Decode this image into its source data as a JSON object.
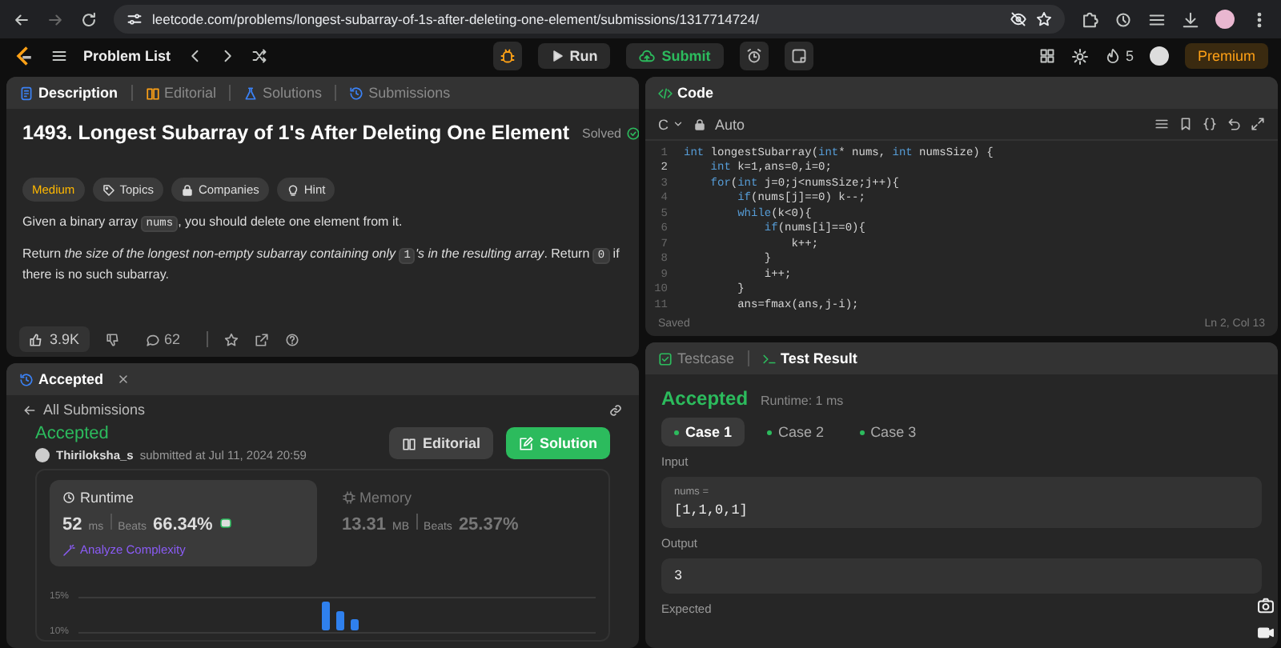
{
  "browser": {
    "url": "leetcode.com/problems/longest-subarray-of-1s-after-deleting-one-element/submissions/1317714724/"
  },
  "topbar": {
    "problem_list": "Problem List",
    "run": "Run",
    "submit": "Submit",
    "streak": "5",
    "premium": "Premium"
  },
  "description": {
    "tabs": [
      {
        "label": "Description",
        "selected": true
      },
      {
        "label": "Editorial",
        "selected": false
      },
      {
        "label": "Solutions",
        "selected": false
      },
      {
        "label": "Submissions",
        "selected": false
      }
    ],
    "title": "1493. Longest Subarray of 1's After Deleting One Element",
    "status": "Solved",
    "tags": [
      {
        "label": "Medium",
        "kind": "difficulty"
      },
      {
        "label": "Topics",
        "kind": "topics"
      },
      {
        "label": "Companies",
        "kind": "companies"
      },
      {
        "label": "Hint",
        "kind": "hint"
      }
    ],
    "paragraphs": [
      [
        {
          "kind": "plain",
          "text": "Given a binary array "
        },
        {
          "kind": "code",
          "text": "nums"
        },
        {
          "kind": "plain",
          "text": ", you should delete one element from it."
        }
      ],
      [
        {
          "kind": "plain",
          "text": "Return "
        },
        {
          "kind": "italic",
          "text": "the size of the longest non-empty subarray containing only "
        },
        {
          "kind": "code",
          "text": "1"
        },
        {
          "kind": "italic",
          "text": "'s in the resulting array"
        },
        {
          "kind": "plain",
          "text": ". Return "
        },
        {
          "kind": "code",
          "text": "0"
        },
        {
          "kind": "plain",
          "text": " if there is no such subarray."
        }
      ]
    ],
    "likes": "3.9K",
    "comments": "62"
  },
  "submission": {
    "tab": "Accepted",
    "back": "All Submissions",
    "status": "Accepted",
    "user": "Thiriloksha_s",
    "submitted": "submitted at Jul 11, 2024 20:59",
    "editorial": "Editorial",
    "solution": "Solution",
    "stats": [
      {
        "label": "Runtime",
        "kind": "runtime",
        "selected": true,
        "value": "52",
        "unit": "ms",
        "beats_label": "Beats",
        "beats": "66.34%"
      },
      {
        "label": "Memory",
        "kind": "memory",
        "selected": false,
        "value": "13.31",
        "unit": "MB",
        "beats_label": "Beats",
        "beats": "25.37%"
      }
    ],
    "analyze": "Analyze Complexity",
    "chart_ticks": [
      "15%",
      "10%"
    ]
  },
  "code": {
    "tab": "Code",
    "language": "C",
    "mode": "Auto",
    "saved": "Saved",
    "cursor": "Ln 2, Col 13",
    "lines": [
      {
        "number": "1",
        "current": false,
        "tokens": [
          {
            "keyword": true,
            "text": "int"
          },
          {
            "keyword": false,
            "text": " longestSubarray("
          },
          {
            "keyword": true,
            "text": "int"
          },
          {
            "keyword": false,
            "text": "* nums, "
          },
          {
            "keyword": true,
            "text": "int"
          },
          {
            "keyword": false,
            "text": " numsSize) {"
          }
        ]
      },
      {
        "number": "2",
        "current": true,
        "tokens": [
          {
            "keyword": true,
            "text": "    int"
          },
          {
            "keyword": false,
            "text": " k=1,ans=0,i=0;"
          }
        ]
      },
      {
        "number": "3",
        "current": false,
        "tokens": [
          {
            "keyword": true,
            "text": "    for"
          },
          {
            "keyword": false,
            "text": "("
          },
          {
            "keyword": true,
            "text": "int"
          },
          {
            "keyword": false,
            "text": " j=0;j<numsSize;j++){"
          }
        ]
      },
      {
        "number": "4",
        "current": false,
        "tokens": [
          {
            "keyword": true,
            "text": "        if"
          },
          {
            "keyword": false,
            "text": "(nums[j]==0) k--;"
          }
        ]
      },
      {
        "number": "5",
        "current": false,
        "tokens": [
          {
            "keyword": true,
            "text": "        while"
          },
          {
            "keyword": false,
            "text": "(k<0){"
          }
        ]
      },
      {
        "number": "6",
        "current": false,
        "tokens": [
          {
            "keyword": true,
            "text": "            if"
          },
          {
            "keyword": false,
            "text": "(nums[i]==0){"
          }
        ]
      },
      {
        "number": "7",
        "current": false,
        "tokens": [
          {
            "keyword": false,
            "text": "                k++;"
          }
        ]
      },
      {
        "number": "8",
        "current": false,
        "tokens": [
          {
            "keyword": false,
            "text": "            }"
          }
        ]
      },
      {
        "number": "9",
        "current": false,
        "tokens": [
          {
            "keyword": false,
            "text": "            i++;"
          }
        ]
      },
      {
        "number": "10",
        "current": false,
        "tokens": [
          {
            "keyword": false,
            "text": "        }"
          }
        ]
      },
      {
        "number": "11",
        "current": false,
        "tokens": [
          {
            "keyword": false,
            "text": "        ans=fmax(ans,j-i);"
          }
        ]
      }
    ]
  },
  "result": {
    "tabs": [
      {
        "label": "Testcase",
        "selected": false
      },
      {
        "label": "Test Result",
        "selected": true
      }
    ],
    "status": "Accepted",
    "runtime": "Runtime: 1 ms",
    "cases": [
      {
        "label": "Case 1",
        "selected": true
      },
      {
        "label": "Case 2",
        "selected": false
      },
      {
        "label": "Case 3",
        "selected": false
      }
    ],
    "input_label": "Input",
    "input_name": "nums =",
    "input_value": "[1,1,0,1]",
    "output_label": "Output",
    "output_value": "3",
    "expected_label": "Expected"
  }
}
